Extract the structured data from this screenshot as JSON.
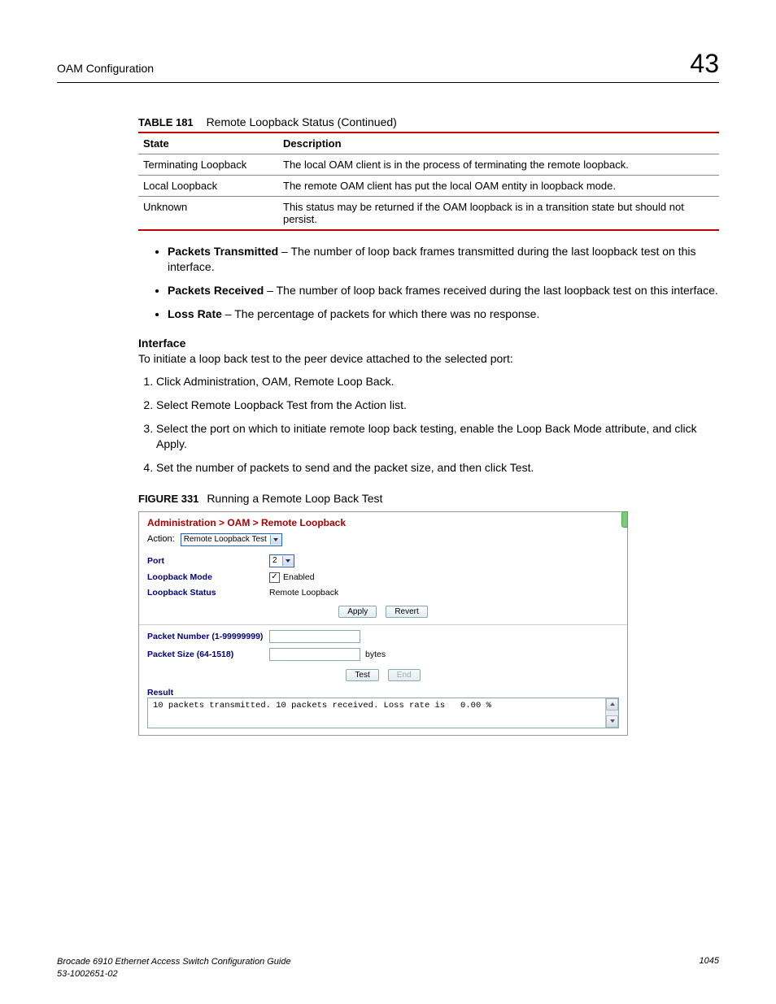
{
  "header": {
    "section": "OAM Configuration",
    "chapter": "43"
  },
  "table": {
    "number": "TABLE 181",
    "title": "Remote Loopback Status (Continued)",
    "cols": {
      "state": "State",
      "desc": "Description"
    },
    "rows": [
      {
        "state": "Terminating Loopback",
        "desc": "The local OAM client is in the process of terminating the remote loopback."
      },
      {
        "state": "Local Loopback",
        "desc": "The remote OAM client has put the local OAM entity in loopback mode."
      },
      {
        "state": "Unknown",
        "desc": "This status may be returned if the OAM loopback is in a transition state but should not persist."
      }
    ]
  },
  "bullets": [
    {
      "b": "Packets Transmitted",
      "t": " – The number of loop back frames transmitted during the last loopback test on this interface."
    },
    {
      "b": "Packets Received",
      "t": " – The number of loop back frames received during the last loopback test on this interface."
    },
    {
      "b": "Loss Rate",
      "t": " – The percentage of packets for which there was no response."
    }
  ],
  "interface": {
    "heading": "Interface",
    "intro": "To initiate a loop back test to the peer device attached to the selected port:",
    "steps": [
      "Click Administration, OAM, Remote Loop Back.",
      "Select Remote Loopback Test from the Action list.",
      "Select the port on which to initiate remote loop back testing, enable the Loop Back Mode attribute, and click Apply.",
      "Set the number of packets to send and the packet size, and then click Test."
    ]
  },
  "figure": {
    "number": "FIGURE 331",
    "title": "Running a Remote Loop Back Test",
    "breadcrumb": "Administration > OAM > Remote Loopback",
    "action_label": "Action:",
    "action_value": "Remote Loopback Test",
    "fields": {
      "port_label": "Port",
      "port_value": "2",
      "mode_label": "Loopback Mode",
      "mode_text": "Enabled",
      "status_label": "Loopback Status",
      "status_value": "Remote Loopback",
      "pkt_num_label": "Packet Number (1-99999999)",
      "pkt_size_label": "Packet Size (64-1518)",
      "pkt_size_unit": "bytes"
    },
    "buttons": {
      "apply": "Apply",
      "revert": "Revert",
      "test": "Test",
      "end": "End"
    },
    "result_heading": "Result",
    "result_text": "10 packets transmitted. 10 packets received. Loss rate is   0.00 %"
  },
  "footer": {
    "line1": "Brocade 6910 Ethernet Access Switch Configuration Guide",
    "line2": "53-1002651-02",
    "page": "1045"
  }
}
